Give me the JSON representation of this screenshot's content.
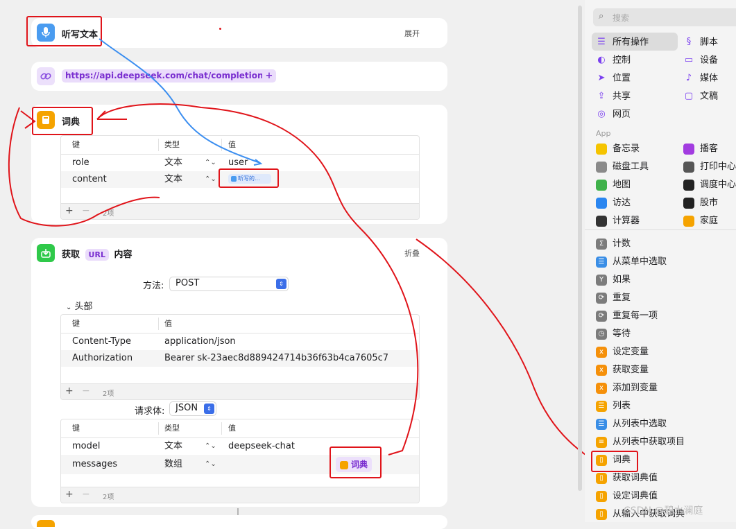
{
  "dictate": {
    "title": "听写文本",
    "expand": "展开"
  },
  "url_action": {
    "url": "https://api.deepseek.com/chat/completions",
    "add": "+"
  },
  "dict1": {
    "title": "词典",
    "headers": [
      "键",
      "类型",
      "值"
    ],
    "rows": [
      {
        "key": "role",
        "type": "文本",
        "value": "user"
      },
      {
        "key": "content",
        "type": "文本",
        "value": "听写的..."
      }
    ],
    "count": "2项"
  },
  "fetch": {
    "title_prefix": "获取",
    "url_chip": "URL",
    "title_suffix": "内容",
    "collapse": "折叠",
    "method_label": "方法:",
    "method_value": "POST",
    "headers_toggle": "头部",
    "hdr_headers": [
      "键",
      "值"
    ],
    "hdr_rows": [
      {
        "key": "Content-Type",
        "value": "application/json"
      },
      {
        "key": "Authorization",
        "value": "Bearer sk-23aec8d889424714b36f63b4ca7605c7"
      }
    ],
    "hdr_count": "2项",
    "body_label": "请求体:",
    "body_value": "JSON",
    "body_headers": [
      "键",
      "类型",
      "值"
    ],
    "body_rows": [
      {
        "key": "model",
        "type": "文本",
        "value": "deepseek-chat"
      },
      {
        "key": "messages",
        "type": "数组",
        "value": "词典"
      }
    ],
    "body_count": "2项"
  },
  "sidebar": {
    "search_placeholder": "搜索",
    "categories": [
      {
        "label": "所有操作",
        "icon": "list-icon"
      },
      {
        "label": "脚本",
        "icon": "script-icon"
      },
      {
        "label": "控制",
        "icon": "toggle-icon"
      },
      {
        "label": "设备",
        "icon": "monitor-icon"
      },
      {
        "label": "位置",
        "icon": "location-icon"
      },
      {
        "label": "媒体",
        "icon": "music-icon"
      },
      {
        "label": "共享",
        "icon": "share-icon"
      },
      {
        "label": "文稿",
        "icon": "document-icon"
      },
      {
        "label": "网页",
        "icon": "compass-icon"
      }
    ],
    "app_section": "App",
    "apps": [
      {
        "label": "备忘录",
        "color": "#f5c400"
      },
      {
        "label": "播客",
        "color": "#a23ce0"
      },
      {
        "label": "磁盘工具",
        "color": "#8a8a8a"
      },
      {
        "label": "打印中心",
        "color": "#555555"
      },
      {
        "label": "地图",
        "color": "#3fb14a"
      },
      {
        "label": "调度中心",
        "color": "#222222"
      },
      {
        "label": "访达",
        "color": "#2a86f0"
      },
      {
        "label": "股市",
        "color": "#222222"
      },
      {
        "label": "计算器",
        "color": "#333333"
      },
      {
        "label": "家庭",
        "color": "#f5a300"
      }
    ],
    "actions": [
      {
        "label": "计数",
        "color": "#7c7c7c",
        "glyph": "Σ"
      },
      {
        "label": "从菜单中选取",
        "color": "#3a8ee6",
        "glyph": "☰"
      },
      {
        "label": "如果",
        "color": "#7c7c7c",
        "glyph": "Y"
      },
      {
        "label": "重复",
        "color": "#7c7c7c",
        "glyph": "⟳"
      },
      {
        "label": "重复每一项",
        "color": "#7c7c7c",
        "glyph": "⟳"
      },
      {
        "label": "等待",
        "color": "#7c7c7c",
        "glyph": "◷"
      },
      {
        "label": "设定变量",
        "color": "#f5900a",
        "glyph": "x"
      },
      {
        "label": "获取变量",
        "color": "#f5900a",
        "glyph": "x"
      },
      {
        "label": "添加到变量",
        "color": "#f5900a",
        "glyph": "x"
      },
      {
        "label": "列表",
        "color": "#f5a300",
        "glyph": "☰"
      },
      {
        "label": "从列表中选取",
        "color": "#3a8ee6",
        "glyph": "☰"
      },
      {
        "label": "从列表中获取项目",
        "color": "#f5a300",
        "glyph": "≡"
      },
      {
        "label": "词典",
        "color": "#f5a300",
        "glyph": "▯"
      },
      {
        "label": "获取词典值",
        "color": "#f5a300",
        "glyph": "▯"
      },
      {
        "label": "设定词典值",
        "color": "#f5a300",
        "glyph": "▯"
      },
      {
        "label": "从输入中获取词典",
        "color": "#f5a300",
        "glyph": "▯"
      }
    ]
  },
  "watermark": "CSDN @碧水澜庭"
}
